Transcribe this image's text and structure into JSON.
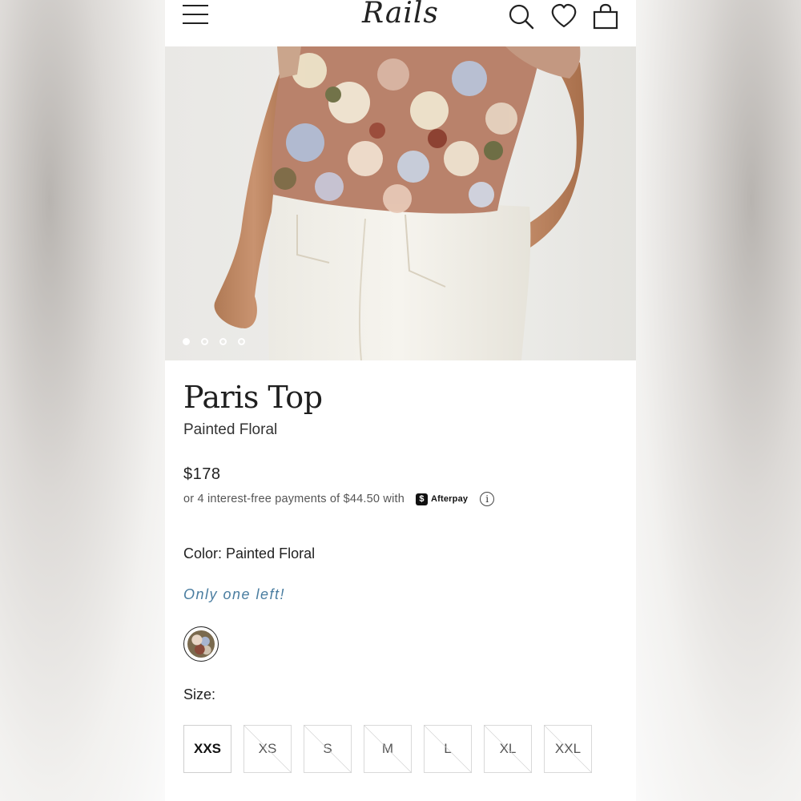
{
  "header": {
    "logo_text": "Rails",
    "menu_icon": "hamburger-menu-icon",
    "search_icon": "search-icon",
    "wishlist_icon": "heart-icon",
    "cart_icon": "shopping-bag-icon"
  },
  "gallery": {
    "image_count": 4,
    "active_index": 0
  },
  "product": {
    "name": "Paris Top",
    "variant": "Painted Floral",
    "price": "$178",
    "afterpay_text": "or 4 interest-free payments of $44.50 with",
    "afterpay_brand": "Afterpay",
    "color_label": "Color:",
    "color_value": "Painted Floral",
    "stock_message": "Only one left!",
    "size_label": "Size:",
    "sizes": [
      {
        "label": "XXS",
        "available": true
      },
      {
        "label": "XS",
        "available": false
      },
      {
        "label": "S",
        "available": false
      },
      {
        "label": "M",
        "available": false
      },
      {
        "label": "L",
        "available": false
      },
      {
        "label": "XL",
        "available": false
      },
      {
        "label": "XXL",
        "available": false
      }
    ]
  },
  "colors": {
    "stock_text": "#4a7da0",
    "text": "#222222"
  }
}
